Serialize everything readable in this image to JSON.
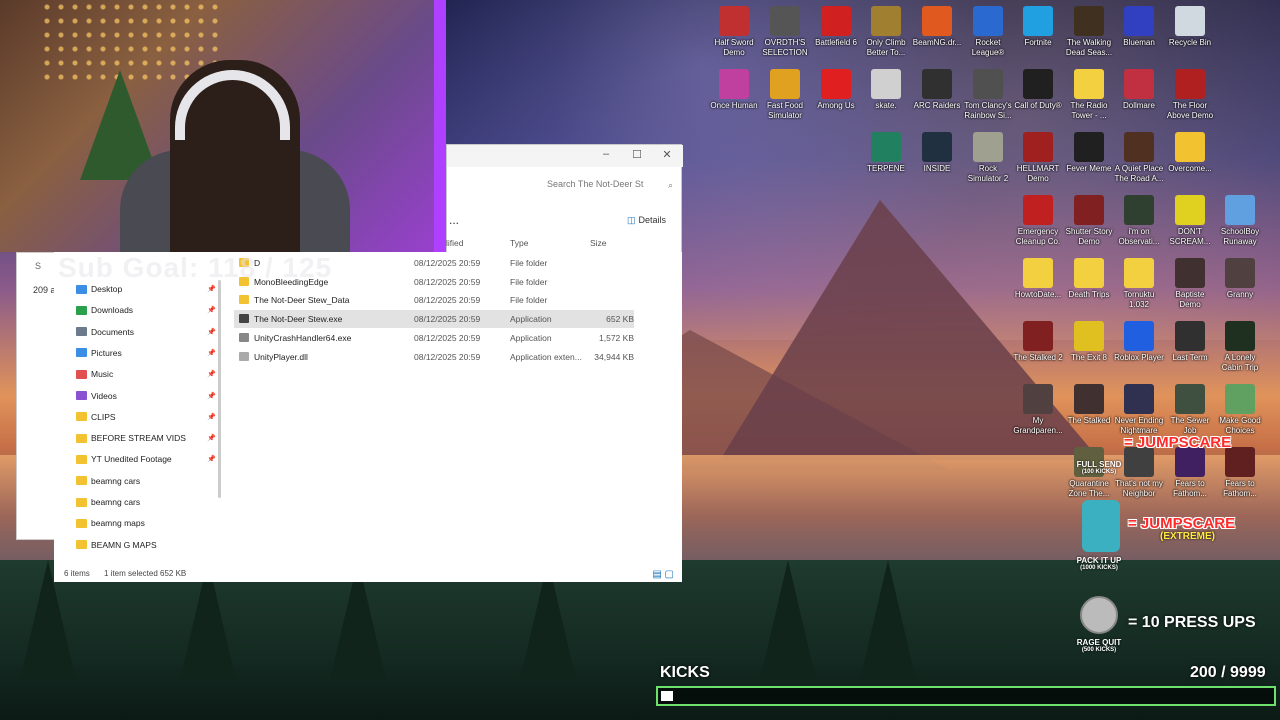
{
  "webcam": {
    "sub_goal": "Sub Goal: 118 / 125"
  },
  "explorer_back": {
    "path_fragment": "S",
    "count": "209 a"
  },
  "explorer": {
    "search_placeholder": "Search The Not-Deer St",
    "more_label": "...",
    "details_label": "Details",
    "columns": {
      "modified": "lified",
      "type": "Type",
      "size": "Size"
    },
    "sidebar": [
      {
        "label": "Desktop",
        "color": "#3a8ee6"
      },
      {
        "label": "Downloads",
        "color": "#2aa04a"
      },
      {
        "label": "Documents",
        "color": "#6b7b8c"
      },
      {
        "label": "Pictures",
        "color": "#3a8ee6"
      },
      {
        "label": "Music",
        "color": "#e05050"
      },
      {
        "label": "Videos",
        "color": "#8a50d0"
      },
      {
        "label": "CLIPS",
        "color": "#f2c230"
      },
      {
        "label": "BEFORE STREAM VIDS",
        "color": "#f2c230"
      },
      {
        "label": "YT Unedited Footage",
        "color": "#f2c230"
      },
      {
        "label": "beamng cars",
        "color": "#f2c230"
      },
      {
        "label": "beamng cars",
        "color": "#f2c230"
      },
      {
        "label": "beamng maps",
        "color": "#f2c230"
      },
      {
        "label": "BEAMN G MAPS",
        "color": "#f2c230"
      }
    ],
    "files": [
      {
        "name": "D",
        "date": "08/12/2025 20:59",
        "type": "File folder",
        "size": "",
        "color": "#f2c230"
      },
      {
        "name": "MonoBleedingEdge",
        "date": "08/12/2025 20:59",
        "type": "File folder",
        "size": "",
        "color": "#f2c230"
      },
      {
        "name": "The Not-Deer Stew_Data",
        "date": "08/12/2025 20:59",
        "type": "File folder",
        "size": "",
        "color": "#f2c230"
      },
      {
        "name": "The Not-Deer Stew.exe",
        "date": "08/12/2025 20:59",
        "type": "Application",
        "size": "652 KB",
        "color": "#444444"
      },
      {
        "name": "UnityCrashHandler64.exe",
        "date": "08/12/2025 20:59",
        "type": "Application",
        "size": "1,572 KB",
        "color": "#888888"
      },
      {
        "name": "UnityPlayer.dll",
        "date": "08/12/2025 20:59",
        "type": "Application exten...",
        "size": "34,944 KB",
        "color": "#aaaaaa"
      }
    ],
    "status": {
      "items": "6 items",
      "selected": "1 item selected  652 KB"
    }
  },
  "desktop_icons": [
    {
      "label": "Half Sword Demo",
      "color": "#c03030"
    },
    {
      "label": "OVRDTH'S SELECTION",
      "color": "#555555"
    },
    {
      "label": "Battlefield 6",
      "color": "#d02020"
    },
    {
      "label": "Only Climb Better To...",
      "color": "#a08030"
    },
    {
      "label": "BeamNG.dr...",
      "color": "#e05a20"
    },
    {
      "label": "Rocket League®",
      "color": "#2a6ad0"
    },
    {
      "label": "Fortnite",
      "color": "#20a0e0"
    },
    {
      "label": "The Walking Dead Seas...",
      "color": "#403020"
    },
    {
      "label": "Blueman",
      "color": "#3040c0"
    },
    {
      "label": "Recycle Bin",
      "color": "#d0d8e0"
    },
    {
      "label": "Once Human",
      "color": "#c040a0"
    },
    {
      "label": "Fast Food Simulator",
      "color": "#e0a020"
    },
    {
      "label": "Among Us",
      "color": "#e02020"
    },
    {
      "label": "skate.",
      "color": "#d0d0d0"
    },
    {
      "label": "ARC Raiders",
      "color": "#303030"
    },
    {
      "label": "Tom Clancy's Rainbow Si...",
      "color": "#505050"
    },
    {
      "label": "Call of Duty®",
      "color": "#202020"
    },
    {
      "label": "The Radio Tower - ...",
      "color": "#f2d040"
    },
    {
      "label": "Dollmare",
      "color": "#c03040"
    },
    {
      "label": "The Floor Above Demo",
      "color": "#b02020"
    },
    {
      "label": "TERPENE",
      "color": "#208060"
    },
    {
      "label": "INSIDE",
      "color": "#203040"
    },
    {
      "label": "Rock Simulator 2",
      "color": "#a0a090"
    },
    {
      "label": "HELLMART Demo",
      "color": "#a02020"
    },
    {
      "label": "Fever Meme",
      "color": "#202020"
    },
    {
      "label": "A Quiet Place The Road A...",
      "color": "#503020"
    },
    {
      "label": "Overcome...",
      "color": "#f2c230"
    },
    {
      "label": "Emergency Cleanup Co.",
      "color": "#c02020"
    },
    {
      "label": "Shutter Story Demo",
      "color": "#802020"
    },
    {
      "label": "i'm on Observati...",
      "color": "#304030"
    },
    {
      "label": "DON'T SCREAM...",
      "color": "#e0d020"
    },
    {
      "label": "SchoolBoy Runaway",
      "color": "#60a0e0"
    },
    {
      "label": "HowtoDate...",
      "color": "#f2d040"
    },
    {
      "label": "Death Trips",
      "color": "#f2d040"
    },
    {
      "label": "Tornuktu 1.032",
      "color": "#f2d040"
    },
    {
      "label": "Baptiste Demo",
      "color": "#403030"
    },
    {
      "label": "Granny",
      "color": "#504040"
    },
    {
      "label": "The Stalked 2",
      "color": "#802020"
    },
    {
      "label": "The Exit 8",
      "color": "#e0c020"
    },
    {
      "label": "Roblox Player",
      "color": "#2060e0"
    },
    {
      "label": "Last Term",
      "color": "#303030"
    },
    {
      "label": "A Lonely Cabin Trip",
      "color": "#203020"
    },
    {
      "label": "My Grandparen...",
      "color": "#504040"
    },
    {
      "label": "The Stalked",
      "color": "#403030"
    },
    {
      "label": "Never Ending Nightmare",
      "color": "#303050"
    },
    {
      "label": "The Sewer Job",
      "color": "#405040"
    },
    {
      "label": "Make Good Choices",
      "color": "#60a060"
    },
    {
      "label": "Quarantine Zone The...",
      "color": "#606040"
    },
    {
      "label": "That's not my Neighbor",
      "color": "#404040"
    },
    {
      "label": "Fears to Fathom...",
      "color": "#402060"
    },
    {
      "label": "Fears to Fathom...",
      "color": "#602020"
    }
  ],
  "overlays": {
    "jumpscare1": "= JUMPSCARE",
    "full_send": "FULL SEND",
    "full_send_sub": "(100 KICKS)",
    "jumpscare2": "= JUMPSCARE",
    "extreme": "(EXTREME)",
    "pack_it_up": "PACK IT UP",
    "pack_it_up_sub": "(1000 KICKS)",
    "press_ups": "= 10 PRESS UPS",
    "rage_quit": "RAGE QUIT",
    "rage_quit_sub": "(500 KICKS)"
  },
  "kicks": {
    "label": "KICKS",
    "count": "200  / 9999",
    "progress": 0.02
  }
}
